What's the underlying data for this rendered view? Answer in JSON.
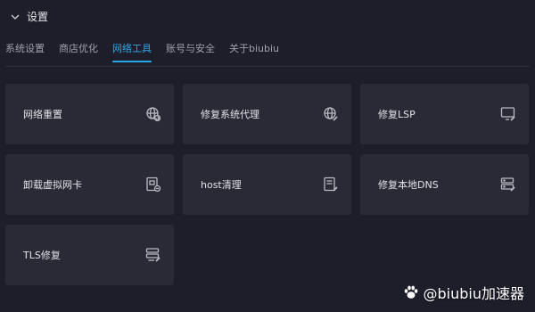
{
  "header": {
    "title": "设置"
  },
  "tabs": [
    {
      "label": "系统设置"
    },
    {
      "label": "商店优化"
    },
    {
      "label": "网络工具"
    },
    {
      "label": "账号与安全"
    },
    {
      "label": "关于biubiu"
    }
  ],
  "active_tab": "网络工具",
  "cards": [
    {
      "label": "网络重置",
      "icon": "globe-refresh-icon"
    },
    {
      "label": "修复系统代理",
      "icon": "globe-wrench-icon"
    },
    {
      "label": "修复LSP",
      "icon": "monitor-wrench-icon"
    },
    {
      "label": "卸载虚拟网卡",
      "icon": "network-card-remove-icon"
    },
    {
      "label": "host清理",
      "icon": "document-broom-icon"
    },
    {
      "label": "修复本地DNS",
      "icon": "server-wrench-icon"
    },
    {
      "label": "TLS修复",
      "icon": "server-document-icon"
    }
  ],
  "watermark": {
    "text": "@biubiu加速器",
    "icon": "paw-icon"
  },
  "colors": {
    "background": "#1e1e2b",
    "card": "#2a2a37",
    "accent": "#2aa7e8"
  }
}
